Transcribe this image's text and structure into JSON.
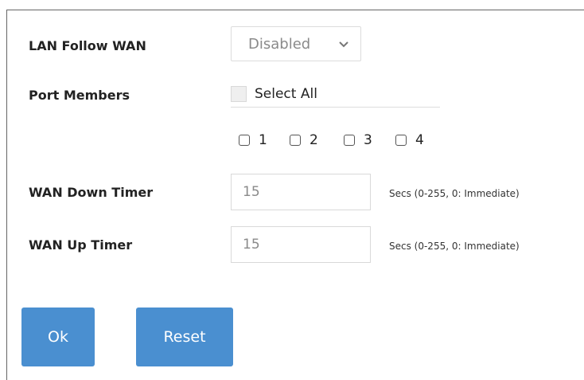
{
  "form": {
    "lan_follow_wan": {
      "label": "LAN Follow WAN",
      "selected": "Disabled"
    },
    "port_members": {
      "label": "Port Members",
      "select_all_label": "Select All",
      "ports": [
        "1",
        "2",
        "3",
        "4"
      ]
    },
    "wan_down_timer": {
      "label": "WAN Down Timer",
      "value": "15",
      "hint": "Secs (0-255, 0: Immediate)"
    },
    "wan_up_timer": {
      "label": "WAN Up Timer",
      "value": "15",
      "hint": "Secs (0-255, 0: Immediate)"
    }
  },
  "buttons": {
    "ok_label": "Ok",
    "reset_label": "Reset"
  },
  "colors": {
    "button_bg": "#4a8fd0",
    "button_text": "#ffffff"
  },
  "icons": {
    "dropdown": "chevron-down-icon"
  }
}
